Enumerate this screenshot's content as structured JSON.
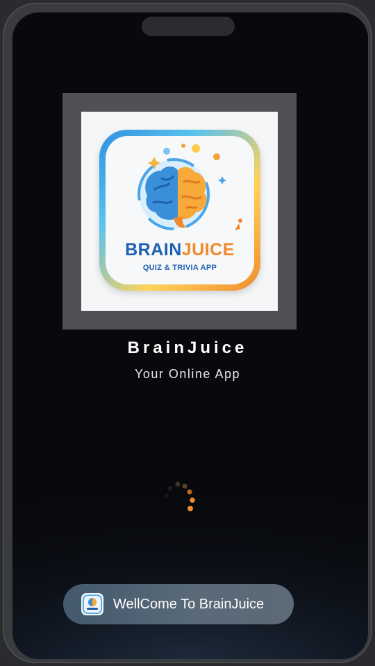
{
  "app": {
    "name": "BrainJuice",
    "tagline": "Your Online App"
  },
  "logo": {
    "title_part1": "BRAIN",
    "title_part2": "JUICE",
    "subtitle": "QUIZ & TRIVIA APP"
  },
  "toast": {
    "message": "WellCome To BrainJuice"
  },
  "loading": {
    "indicator": "spinner",
    "color": "#f08a2c"
  },
  "colors": {
    "background": "#08090c",
    "logo_frame": "#505154",
    "logo_blue": "#1f5fb0",
    "logo_orange": "#f08a2c",
    "toast_background": "#4d5f71"
  },
  "icons": {
    "brain_logo": "brain-logo-icon",
    "toast_app_icon": "app-icon"
  }
}
